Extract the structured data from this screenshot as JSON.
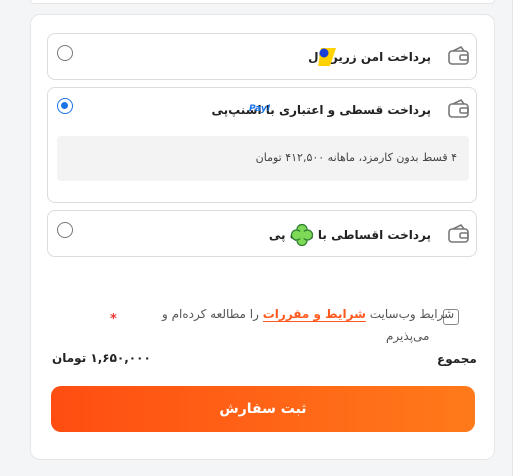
{
  "payment_options": [
    {
      "title": "پرداخت امن زرین‌پال",
      "selected": false,
      "icon": "card-icon",
      "brand_icon": "zarinpal-logo"
    },
    {
      "title": "پرداخت قسطی و اعتباری با اسنپ‌پی",
      "selected": true,
      "icon": "card-icon",
      "brand_icon": "snapp-pay-logo",
      "brand_text": "Pay!",
      "detail": "۴ قسط بدون کارمزد، ماهانه ۴۱۲,۵۰۰ تومان"
    },
    {
      "title": "پرداخت اقساطی با ترب پی",
      "selected": false,
      "icon": "card-icon",
      "brand_icon": "torob-pay-logo"
    }
  ],
  "terms": {
    "prefix": "شرایط وب‌سایت",
    "link": "شرایط و مقررات",
    "suffix": "را مطالعه کرده‌ام و",
    "line2": "می‌پذیرم",
    "required_mark": "*",
    "checked": false
  },
  "summary": {
    "label": "مجموع",
    "value": "۱,۶۵۰,۰۰۰ تومان"
  },
  "submit_label": "ثبت سفارش",
  "colors": {
    "accent": "#ff5a1f",
    "radio": "#1a73e8"
  }
}
